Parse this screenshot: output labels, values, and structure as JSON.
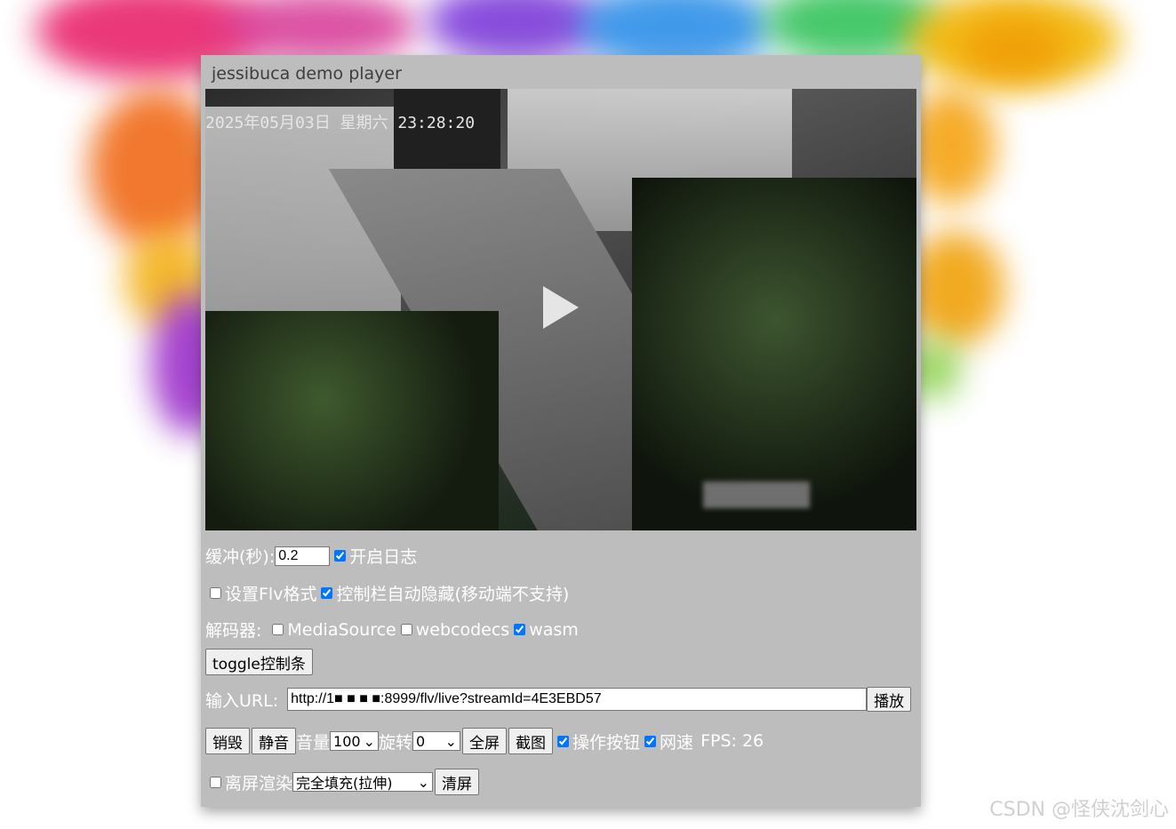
{
  "player": {
    "title": "jessibuca demo player",
    "osd_text": "2025年05月03日 星期六 23:28:20"
  },
  "controls": {
    "buffer_label": "缓冲(秒):",
    "buffer_value": "0.2",
    "log_label": "开启日志",
    "log_checked": true,
    "flv_label": "设置Flv格式",
    "flv_checked": false,
    "autohide_label": "控制栏自动隐藏(移动端不支持)",
    "autohide_checked": true,
    "decoder_label": "解码器:",
    "decoders": [
      {
        "label": "MediaSource",
        "checked": false
      },
      {
        "label": "webcodecs",
        "checked": false
      },
      {
        "label": "wasm",
        "checked": true
      }
    ],
    "toggle_button": "toggle控制条",
    "url_label": "输入URL:",
    "url_value": "http://1■ ■ ■ ■:8999/flv/live?streamId=4E3EBD57",
    "play_button": "播放",
    "destroy_button": "销毁",
    "mute_button": "静音",
    "volume_label": "音量",
    "volume_value": "100",
    "rotate_label": "旋转",
    "rotate_value": "0",
    "fullscreen_button": "全屏",
    "screenshot_button": "截图",
    "operate_label": "操作按钮",
    "operate_checked": true,
    "speed_label": "网速",
    "speed_checked": true,
    "fps_text": "FPS:  26",
    "offscreen_label": "离屏渲染",
    "offscreen_checked": false,
    "fill_mode_value": "完全填充(拉伸)",
    "clear_button": "清屏"
  },
  "watermark": "CSDN @怪侠沈剑心"
}
